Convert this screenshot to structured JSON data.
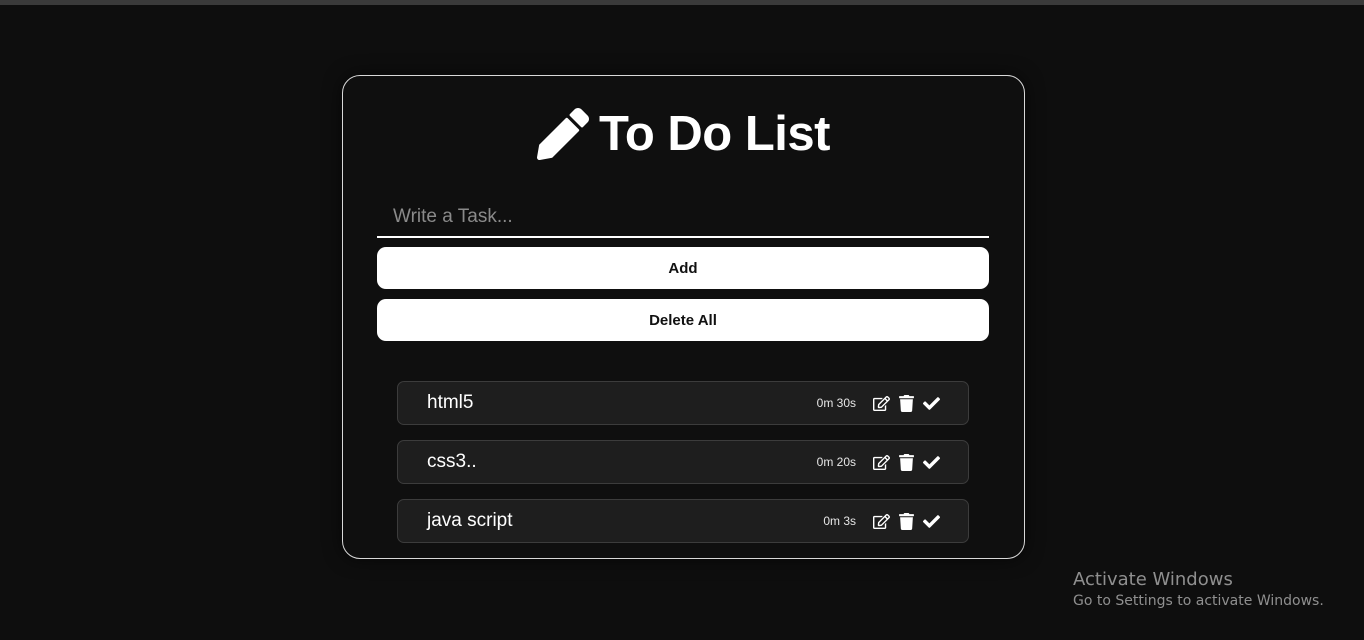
{
  "app": {
    "title": "To Do List",
    "title_icon": "pencil-icon"
  },
  "input": {
    "placeholder": "Write a Task...",
    "value": ""
  },
  "buttons": {
    "add_label": "Add",
    "delete_all_label": "Delete All"
  },
  "tasks": [
    {
      "name": "html5",
      "time": "0m 30s"
    },
    {
      "name": "css3..",
      "time": "0m 20s"
    },
    {
      "name": "java script",
      "time": "0m 3s"
    }
  ],
  "task_actions": [
    "edit-icon",
    "trash-icon",
    "check-icon"
  ],
  "watermark": {
    "title": "Activate Windows",
    "subtitle": "Go to Settings to activate Windows."
  },
  "colors": {
    "background": "#0e0e0e",
    "card_border": "#d9d9d9",
    "button_bg": "#ffffff",
    "task_bg": "#1e1e1e"
  }
}
